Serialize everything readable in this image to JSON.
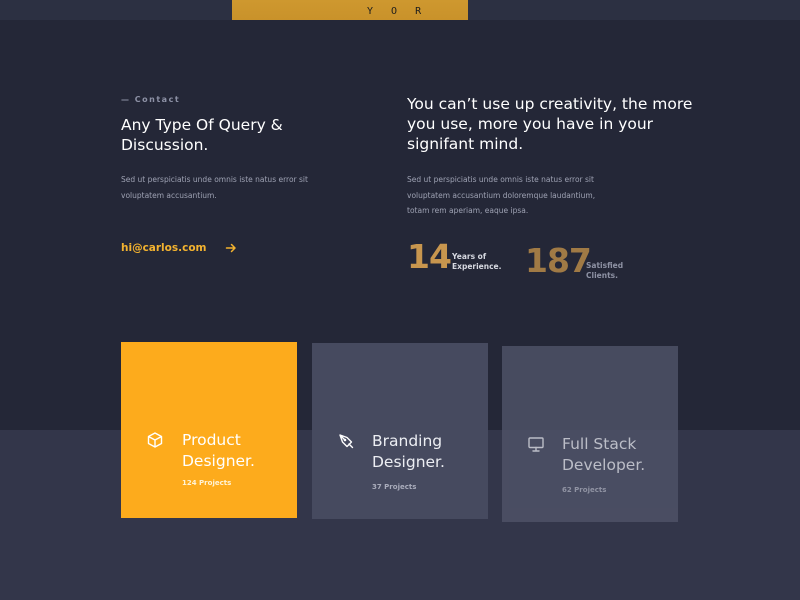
{
  "hero": {
    "shirt_text": "Y O R"
  },
  "contact": {
    "eyebrow": "— Contact",
    "title": "Any Type Of Query & Discussion.",
    "description": "Sed ut perspiciatis unde omnis iste natus error sit voluptatem accusantium.",
    "email": "hi@carlos.com",
    "arrow_icon": "arrow-right-icon"
  },
  "about": {
    "quote": "You can’t use up creativity, the more you use, more you have in your signifant mind.",
    "description": "Sed ut perspiciatis unde omnis iste natus error sit voluptatem accusantium doloremque laudantium, totam rem aperiam, eaque ipsa.",
    "stats": [
      {
        "number": "14",
        "label": "Years of Experience."
      },
      {
        "number": "187",
        "label": "Satisfied Clients."
      }
    ]
  },
  "services": [
    {
      "icon": "cube-icon",
      "title": "Product Designer.",
      "count": "124 Projects"
    },
    {
      "icon": "pen-tool-icon",
      "title": "Branding Designer.",
      "count": "37 Projects"
    },
    {
      "icon": "monitor-icon",
      "title": "Full Stack Developer.",
      "count": "62 Projects"
    }
  ],
  "colors": {
    "background": "#242737",
    "accent": "#fdab1c",
    "stat_gold": "#c8964e",
    "card_grey": "#464a5f"
  }
}
